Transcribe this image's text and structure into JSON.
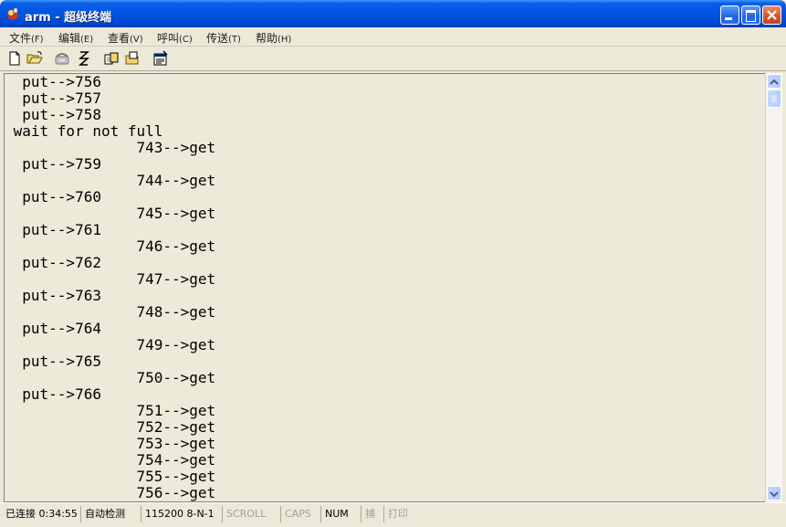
{
  "window": {
    "title": "arm - 超级终端"
  },
  "menu": [
    {
      "label": "文件",
      "accel": "(F)"
    },
    {
      "label": "编辑",
      "accel": "(E)"
    },
    {
      "label": "查看",
      "accel": "(V)"
    },
    {
      "label": "呼叫",
      "accel": "(C)"
    },
    {
      "label": "传送",
      "accel": "(T)"
    },
    {
      "label": "帮助",
      "accel": "(H)"
    }
  ],
  "toolbar": {
    "icons": [
      "new-file-icon",
      "open-folder-icon",
      "call-icon",
      "disconnect-icon",
      "send-icon",
      "receive-icon",
      "properties-icon"
    ]
  },
  "terminal": {
    "lines": [
      "  put-->756",
      "  put-->757",
      "  put-->758",
      " wait for not full",
      "               743-->get",
      "  put-->759",
      "               744-->get",
      "  put-->760",
      "               745-->get",
      "  put-->761",
      "               746-->get",
      "  put-->762",
      "               747-->get",
      "  put-->763",
      "               748-->get",
      "  put-->764",
      "               749-->get",
      "  put-->765",
      "               750-->get",
      "  put-->766",
      "               751-->get",
      "               752-->get",
      "               753-->get",
      "               754-->get",
      "               755-->get",
      "               756-->get"
    ]
  },
  "statusbar": {
    "connection": "已连接 0:34:55",
    "detect": "自动检测",
    "port_settings": "115200 8-N-1",
    "scroll": "SCROLL",
    "caps": "CAPS",
    "num": "NUM",
    "capture": "捕",
    "print": "打印"
  }
}
